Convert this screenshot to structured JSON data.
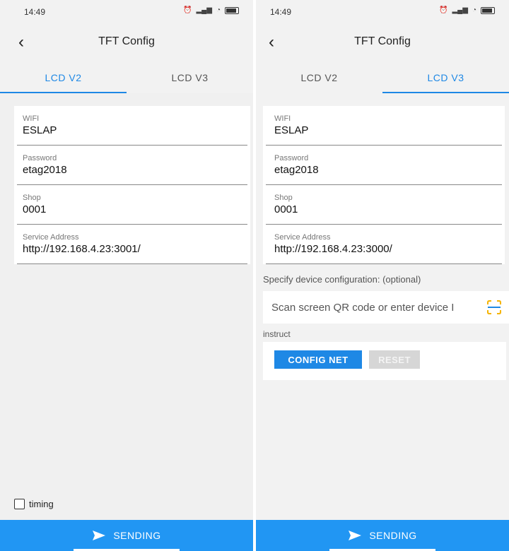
{
  "left": {
    "status": {
      "time": "14:49"
    },
    "title": "TFT Config",
    "tabs": [
      {
        "label": "LCD V2",
        "active": true
      },
      {
        "label": "LCD V3",
        "active": false
      }
    ],
    "fields": [
      {
        "label": "WIFI",
        "value": "ESLAP"
      },
      {
        "label": "Password",
        "value": "etag2018"
      },
      {
        "label": "Shop",
        "value": "0001"
      },
      {
        "label": "Service Address",
        "value": "http://192.168.4.23:3001/"
      }
    ],
    "timing_label": "timing",
    "send_label": "SENDING"
  },
  "right": {
    "status": {
      "time": "14:49"
    },
    "title": "TFT Config",
    "tabs": [
      {
        "label": "LCD V2",
        "active": false
      },
      {
        "label": "LCD V3",
        "active": true
      }
    ],
    "fields": [
      {
        "label": "WIFI",
        "value": "ESLAP"
      },
      {
        "label": "Password",
        "value": "etag2018"
      },
      {
        "label": "Shop",
        "value": "0001"
      },
      {
        "label": "Service Address",
        "value": "http://192.168.4.23:3000/"
      }
    ],
    "device_config_label": "Specify device configuration: (optional)",
    "device_config_placeholder": "Scan screen QR code or enter device I",
    "instruct_label": "instruct",
    "config_net_label": "CONFIG NET",
    "reset_label": "RESET",
    "send_label": "SENDING"
  },
  "colors": {
    "accent": "#1e88e5",
    "send_bar": "#2196f3",
    "qr_icon": "#f5b400"
  },
  "icons": {
    "back": "chevron-left-icon",
    "scan": "qr-scan-icon",
    "send": "send-arrow-icon"
  }
}
